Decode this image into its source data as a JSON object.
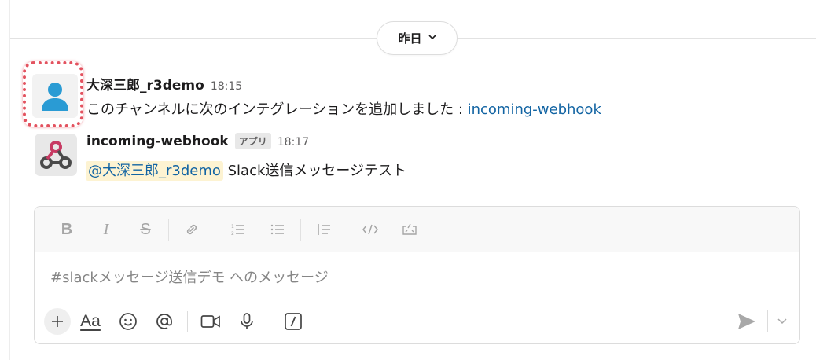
{
  "date_divider": {
    "label": "昨日"
  },
  "messages": [
    {
      "sender": "大深三郎_r3demo",
      "time": "18:15",
      "text": "このチャンネルに次のインテグレーションを追加しました : ",
      "link": "incoming-webhook"
    },
    {
      "sender": "incoming-webhook",
      "badge": "アプリ",
      "time": "18:17",
      "mention": "@大深三郎_r3demo",
      "text": " Slack送信メッセージテスト"
    }
  ],
  "composer": {
    "placeholder": "#slackメッセージ送信デモ へのメッセージ",
    "format_buttons": [
      "bold-icon",
      "italic-icon",
      "strikethrough-icon",
      "link-icon",
      "numbered-list-icon",
      "bulleted-list-icon",
      "blockquote-icon",
      "code-icon",
      "code-block-icon"
    ],
    "tools": [
      "plus-icon",
      "text-format-icon",
      "emoji-icon",
      "mention-icon",
      "video-icon",
      "microphone-icon",
      "slash-command-icon"
    ]
  },
  "colors": {
    "link": "#1264a3",
    "mention_bg": "#fdf3d2",
    "highlight_border": "#e3525f",
    "avatar_blue": "#2a9bd4"
  }
}
